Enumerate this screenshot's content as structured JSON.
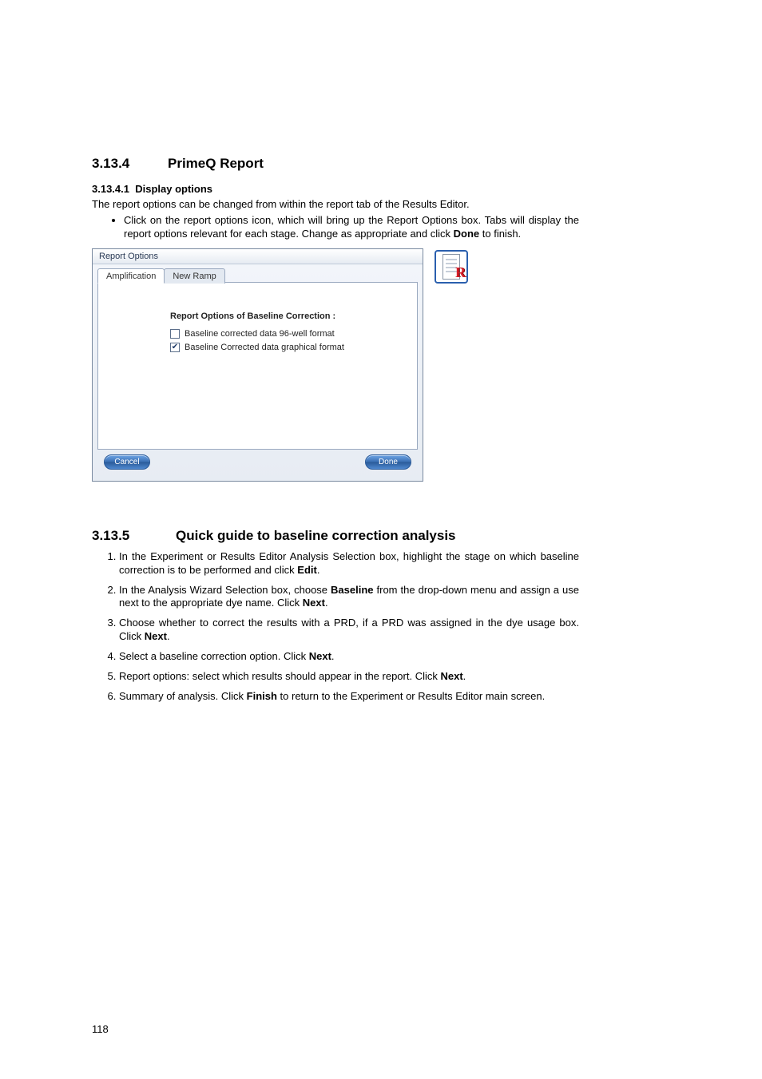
{
  "section_a": {
    "num": "3.13.4",
    "title": "PrimeQ Report"
  },
  "sub_a": {
    "num": "3.13.4.1",
    "title": "Display options"
  },
  "intro_a": "The report options can be changed from within the report tab of the Results Editor.",
  "bullet_a": {
    "pre": "Click on the report options icon, which will bring up the Report Options box. Tabs will display the report options relevant for each stage. Change as appropriate and click ",
    "bold": "Done",
    "post": " to finish."
  },
  "dialog": {
    "title": "Report Options",
    "tabs": [
      "Amplification",
      "New Ramp"
    ],
    "pane_title": "Report Options of Baseline Correction :",
    "check1": {
      "label": "Baseline corrected data 96-well format",
      "checked": false
    },
    "check2": {
      "label": "Baseline Corrected data graphical format",
      "checked": true
    },
    "cancel": "Cancel",
    "done": "Done"
  },
  "icon": {
    "name": "report-options-icon",
    "letter": "R"
  },
  "section_b": {
    "num": "3.13.5",
    "title": "Quick guide to baseline correction analysis"
  },
  "steps": [
    {
      "a": "In the Experiment or Results Editor Analysis Selection box, highlight the stage on which baseline correction is to be performed and click ",
      "b": "Edit",
      "c": "."
    },
    {
      "a": "In the Analysis Wizard Selection box, choose ",
      "b": "Baseline",
      "c": " from the drop-down menu and assign a use next to the appropriate dye name. Click ",
      "d": "Next",
      "e": "."
    },
    {
      "a": "Choose whether to correct the results with a PRD, if a PRD was assigned in the dye usage box. Click ",
      "b": "Next",
      "c": "."
    },
    {
      "a": "Select a baseline correction option. Click ",
      "b": "Next",
      "c": "."
    },
    {
      "a": "Report options: select which results should appear in the report. Click ",
      "b": "Next",
      "c": "."
    },
    {
      "a": "Summary of analysis. Click ",
      "b": "Finish",
      "c": " to return to the Experiment or Results Editor main screen."
    }
  ],
  "page_number": "118"
}
